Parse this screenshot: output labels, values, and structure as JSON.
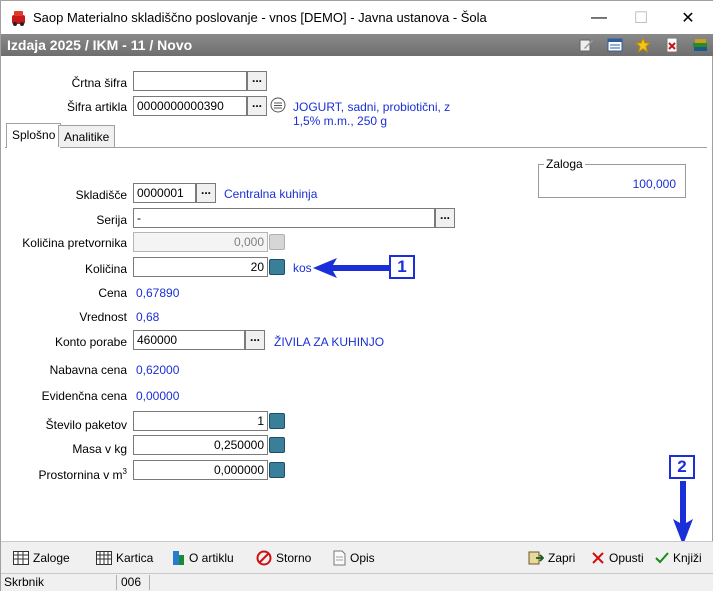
{
  "window": {
    "title": "Saop Materialno skladiščno poslovanje - vnos [DEMO] - Javna ustanova - Šola",
    "minimize": "—",
    "maximize": "☐",
    "close": "✕"
  },
  "header": {
    "title": "Izdaja 2025 / IKM - 11 / Novo",
    "icons": [
      "edit-icon",
      "list-icon",
      "star-icon",
      "delete-doc-icon",
      "books-icon"
    ]
  },
  "article": {
    "crtna_sifra_label": "Črtna šifra",
    "crtna_sifra_value": "",
    "sifra_artikla_label": "Šifra artikla",
    "sifra_artikla_value": "0000000000390",
    "description_line1": "JOGURT, sadni, probiotični, z",
    "description_line2": "1,5% m.m., 250 g"
  },
  "tabs": [
    {
      "label": "Splošno",
      "active": true
    },
    {
      "label": "Analitike",
      "active": false
    }
  ],
  "zaloga": {
    "label": "Zaloga",
    "value": "100,000"
  },
  "form": {
    "skladisce_label": "Skladišče",
    "skladisce_value": "0000001",
    "skladisce_name": "Centralna kuhinja",
    "serija_label": "Serija",
    "serija_value": "-",
    "kolicina_pretvornika_label": "Količina pretvornika",
    "kolicina_pretvornika_value": "0,000",
    "kolicina_label": "Količina",
    "kolicina_value": "20",
    "kolicina_unit": "kos",
    "cena_label": "Cena",
    "cena_value": "0,67890",
    "vrednost_label": "Vrednost",
    "vrednost_value": "0,68",
    "konto_porabe_label": "Konto porabe",
    "konto_porabe_value": "460000",
    "konto_porabe_name": "ŽIVILA ZA KUHINJO",
    "nabavna_cena_label": "Nabavna cena",
    "nabavna_cena_value": "0,62000",
    "evidencna_cena_label": "Evidenčna cena",
    "evidencna_cena_value": "0,00000",
    "stevilo_paketov_label": "Število paketov",
    "stevilo_paketov_value": "1",
    "masa_label": "Masa v kg",
    "masa_value": "0,250000",
    "prostornina_label": "Prostornina v m",
    "prostornina_sup": "3",
    "prostornina_value": "0,000000"
  },
  "annotations": {
    "callout1": "1",
    "callout2": "2",
    "arrow_color": "#1b2fd8"
  },
  "toolbar": {
    "zaloge": "Zaloge",
    "kartica": "Kartica",
    "o_artiklu": "O artiklu",
    "storno": "Storno",
    "opis": "Opis",
    "zapri": "Zapri",
    "opusti": "Opusti",
    "knjizi": "Knjiži"
  },
  "status": {
    "user": "Skrbnik",
    "code": "006",
    "extra": ""
  },
  "colors": {
    "accent_blue": "#1a2fd6",
    "band_gray": "#777777"
  }
}
